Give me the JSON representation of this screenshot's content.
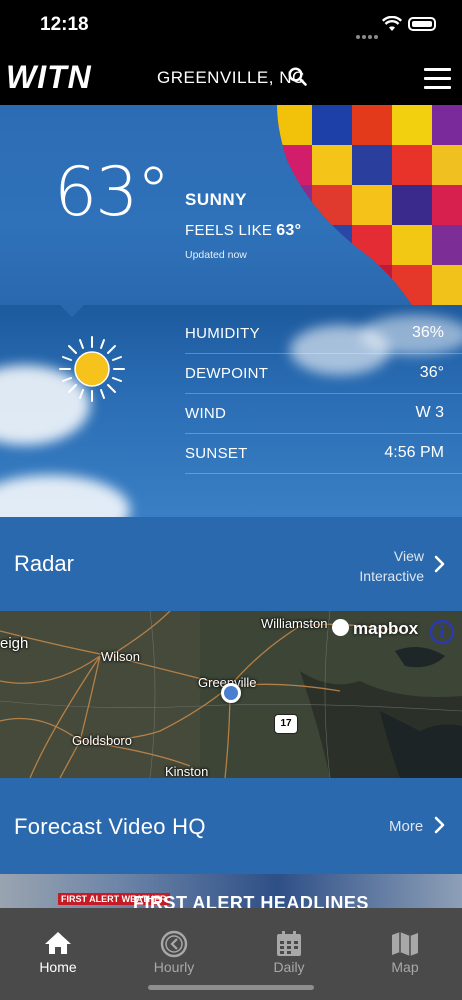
{
  "status": {
    "time": "12:18"
  },
  "header": {
    "logo": "WITN",
    "location": "GREENVILLE, NC"
  },
  "current": {
    "temperature": "63°",
    "condition": "SUNNY",
    "feels_like_label": "FEELS LIKE",
    "feels_like_value": "63°",
    "updated": "Updated now"
  },
  "details": [
    {
      "label": "HUMIDITY",
      "value": "36%"
    },
    {
      "label": "DEWPOINT",
      "value": "36°"
    },
    {
      "label": "WIND",
      "value": "W 3"
    },
    {
      "label": "SUNSET",
      "value": "4:56 PM"
    }
  ],
  "radar": {
    "title": "Radar",
    "view_interactive_line1": "View",
    "view_interactive_line2": "Interactive",
    "map_attribution": "mapbox",
    "map_labels": [
      "eigh",
      "Wilson",
      "Williamston",
      "Greenville",
      "Goldsboro",
      "Kinston"
    ],
    "route_label": "17"
  },
  "forecast_video": {
    "title": "Forecast Video HQ",
    "more": "More",
    "thumbnail_badge": "FIRST ALERT WEATHER",
    "thumbnail_headline": "FIRST ALERT HEADLINES"
  },
  "tabs": [
    {
      "label": "Home",
      "icon": "house-icon",
      "active": true
    },
    {
      "label": "Hourly",
      "icon": "clock-icon",
      "active": false
    },
    {
      "label": "Daily",
      "icon": "calendar-icon",
      "active": false
    },
    {
      "label": "Map",
      "icon": "map-icon",
      "active": false
    }
  ]
}
